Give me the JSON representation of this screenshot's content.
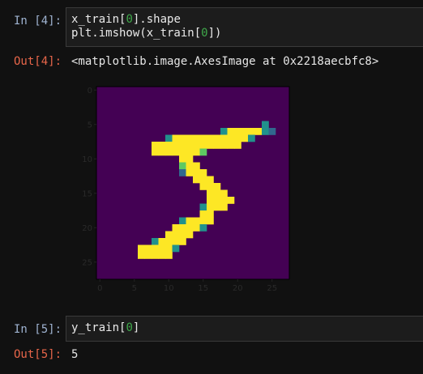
{
  "cells": [
    {
      "in_prompt": "In [4]:",
      "code": {
        "l1_pre": "x_train[",
        "l1_num": "0",
        "l1_post": "].shape",
        "l2_pre": "plt.imshow(x_train[",
        "l2_num": "0",
        "l2_post": "])"
      },
      "out_prompt": "Out[4]:",
      "output_text": "<matplotlib.image.AxesImage at 0x2218aecbfc8>"
    },
    {
      "in_prompt": "In [5]:",
      "code": {
        "l1_pre": "y_train[",
        "l1_num": "0",
        "l1_post": "]"
      },
      "out_prompt": "Out[5]:",
      "output_text": "5"
    }
  ],
  "chart_data": {
    "type": "heatmap",
    "colormap": "viridis",
    "colors": {
      "background": "#440154",
      "mid": "#21918c",
      "high": "#fde725"
    },
    "xlim": [
      -0.5,
      27.5
    ],
    "ylim": [
      27.5,
      -0.5
    ],
    "xticks": [
      "0",
      "5",
      "10",
      "15",
      "20",
      "25"
    ],
    "yticks": [
      "0",
      "5",
      "10",
      "15",
      "20",
      "25"
    ],
    "rows": [
      "............................",
      "............................",
      "............................",
      "............................",
      "............................",
      "........................2...",
      "..................24444421..",
      "..........2444444444442.....",
      "........4444444444444.......",
      "........44444443............",
      "............44...............",
      "............344.............",
      "............1444............",
      "..............444...........",
      "...............444..........",
      "................444.........",
      "................4444........",
      "...............2444.........",
      "...............44...........",
      "............24444...........",
      "...........44442............",
      "..........4444..............",
      "........24444...............",
      "......444442................",
      "......44444.................",
      "............................",
      "............................",
      "............................"
    ]
  }
}
